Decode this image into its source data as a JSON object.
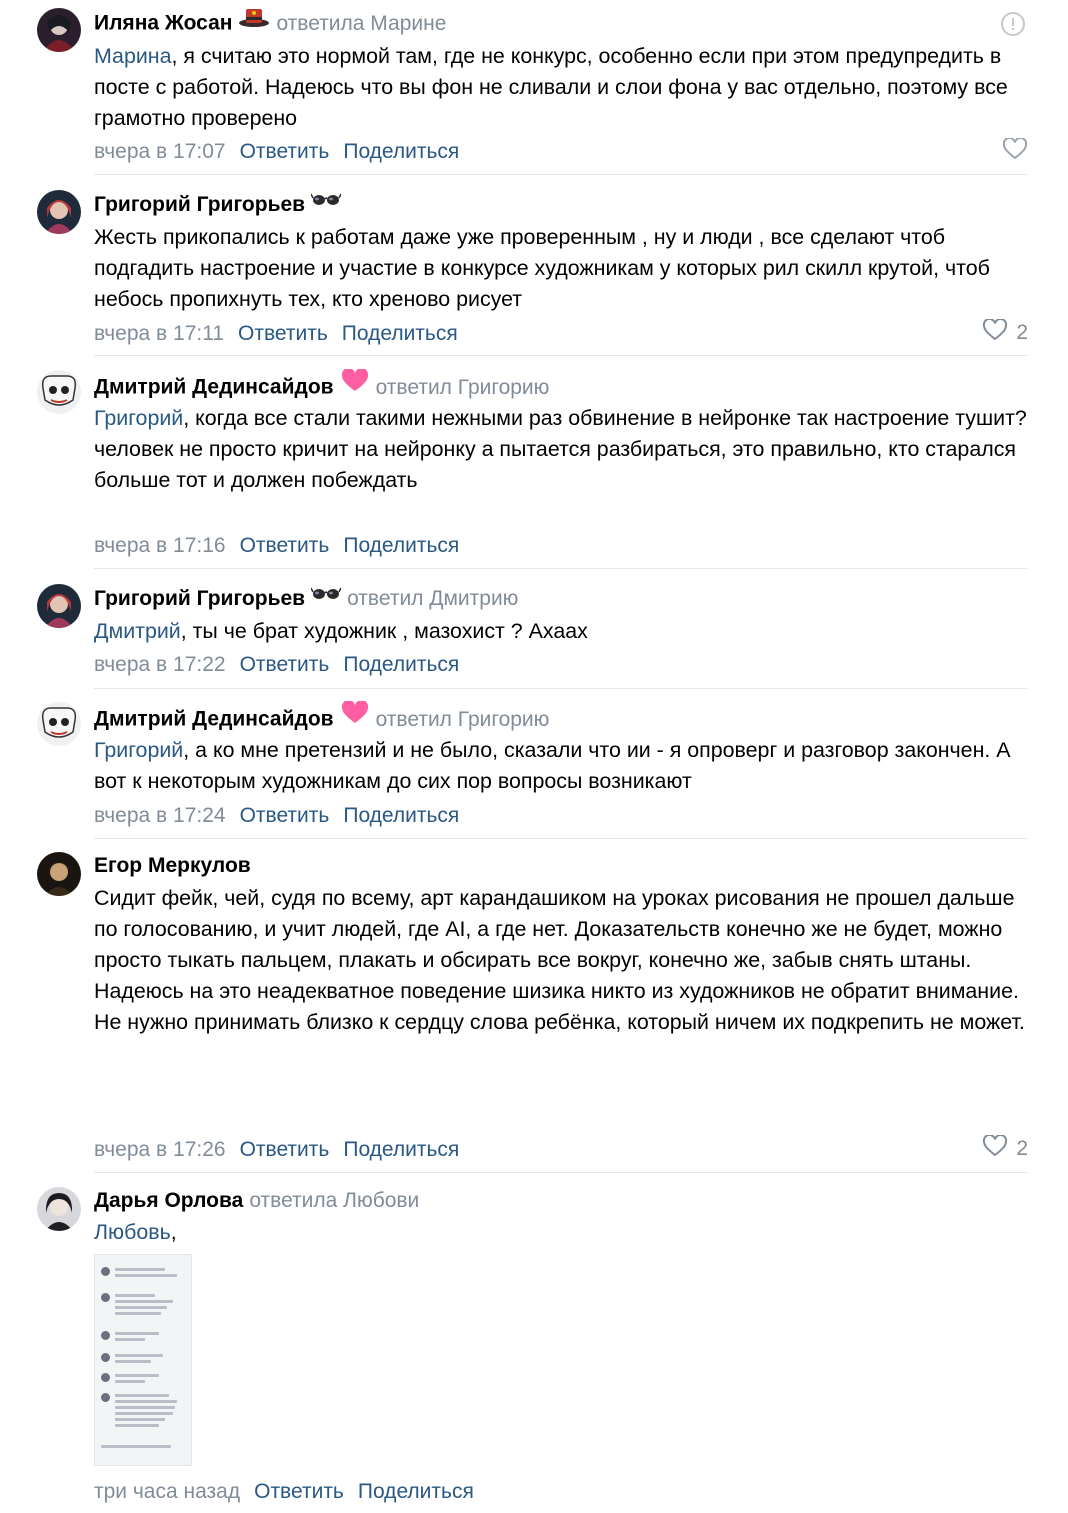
{
  "labels": {
    "reply": "Ответить",
    "share": "Поделиться"
  },
  "comments": [
    {
      "author": "Иляна Жосан",
      "reply_to": "ответила Марине",
      "mention": "Марина",
      "text": ", я считаю это нормой там, где не конкурс, особенно если при этом предупредить в посте с работой. Надеюсь что вы фон не сливали и слои фона у вас отдельно, поэтому все грамотно проверено",
      "time": "вчера в 17:07",
      "likes": "",
      "badge_icon": "hat-badge-icon"
    },
    {
      "author": "Григорий Григорьев",
      "reply_to": "",
      "mention": "",
      "text": "Жесть прикопались к работам даже уже проверенным , ну и люди , все сделают чтоб подгадить настроение и участие в конкурсе художникам у которых рил скилл крутой, чтоб небось пропихнуть тех, кто хреново рисует",
      "time": "вчера в 17:11",
      "likes": "2",
      "badge_icon": "glasses-badge-icon"
    },
    {
      "author": "Дмитрий Дединсайдов",
      "reply_to": "ответил Григорию",
      "mention": "Григорий",
      "text": ", когда все стали такими нежными раз обвинение в нейронке так настроение тушит?\nчеловек не просто кричит на нейронку а пытается разбираться, это правильно, кто старался больше тот и должен побеждать",
      "time": "вчера в 17:16",
      "likes": "",
      "badge_icon": "heart-badge-icon"
    },
    {
      "author": "Григорий Григорьев",
      "reply_to": "ответил Дмитрию",
      "mention": "Дмитрий",
      "text": ", ты че брат художник , мазохист ? Ахаах",
      "time": "вчера в 17:22",
      "likes": "",
      "badge_icon": "glasses-badge-icon"
    },
    {
      "author": "Дмитрий Дединсайдов",
      "reply_to": "ответил Григорию",
      "mention": "Григорий",
      "text": ", а ко мне претензий и не было, сказали что ии - я опроверг и разговор закончен. А вот к некоторым художникам до сих пор вопросы возникают",
      "time": "вчера в 17:24",
      "likes": "",
      "badge_icon": "heart-badge-icon"
    },
    {
      "author": "Егор Меркулов",
      "reply_to": "",
      "mention": "",
      "text": "Сидит фейк, чей, судя по всему, арт карандашиком на уроках рисования не прошел дальше по голосованию, и учит людей, где AI, а где нет. Доказательств конечно же не будет, можно просто тыкать пальцем, плакать и обсирать все вокруг, конечно же, забыв снять штаны.\nНадеюсь на это неадекватное поведение шизика никто из художников не обратит внимание.\nНе нужно принимать близко к сердцу слова ребёнка, который ничем их подкрепить не может.",
      "time": "вчера в 17:26",
      "likes": "2",
      "badge_icon": ""
    },
    {
      "author": "Дарья Орлова",
      "reply_to": "ответила Любови",
      "mention": "Любовь",
      "text": ",",
      "time": "три часа назад",
      "likes": "",
      "badge_icon": "",
      "attachment": "screenshot-attachment"
    }
  ],
  "colors": {
    "link": "#2a5885",
    "muted": "#818c99",
    "separator": "#e7e8ec",
    "heart_badge": "#ff5fa2"
  }
}
